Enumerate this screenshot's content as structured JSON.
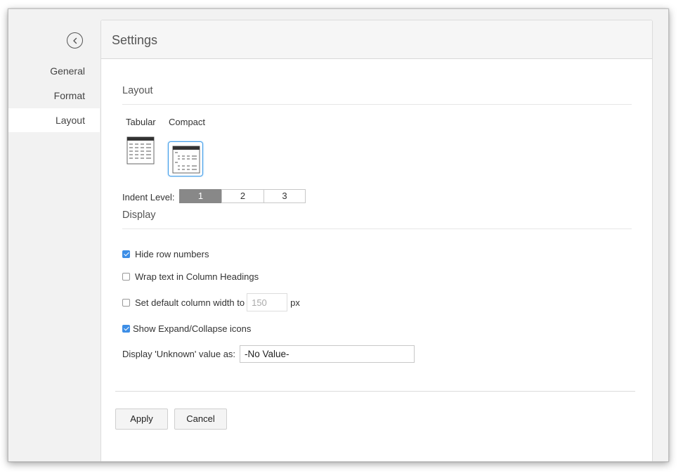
{
  "sidebar": {
    "back_icon": "chevron-left-circle-icon",
    "items": [
      {
        "label": "General"
      },
      {
        "label": "Format"
      },
      {
        "label": "Layout"
      }
    ]
  },
  "panel": {
    "title": "Settings",
    "layout_section": {
      "title": "Layout",
      "options": [
        {
          "label": "Tabular",
          "icon": "tabular-layout-icon",
          "selected": false
        },
        {
          "label": "Compact",
          "icon": "compact-layout-icon",
          "selected": true
        }
      ],
      "indent_label": "Indent Level:",
      "indent_levels": [
        "1",
        "2",
        "3"
      ],
      "indent_selected": "1"
    },
    "display_section": {
      "title": "Display",
      "hide_row_numbers": {
        "label": "Hide row numbers",
        "checked": true
      },
      "wrap_text": {
        "label": "Wrap text in Column Headings",
        "checked": false
      },
      "default_width": {
        "label": "Set default column width to",
        "value": "150",
        "unit": "px",
        "checked": false
      },
      "show_expand": {
        "label": "Show Expand/Collapse icons",
        "checked": true
      },
      "unknown_value": {
        "label": "Display 'Unknown' value as:",
        "value": "-No Value-"
      }
    },
    "buttons": {
      "apply": "Apply",
      "cancel": "Cancel"
    }
  },
  "colors": {
    "accent": "#3d8ee6",
    "active_segment": "#888888"
  }
}
